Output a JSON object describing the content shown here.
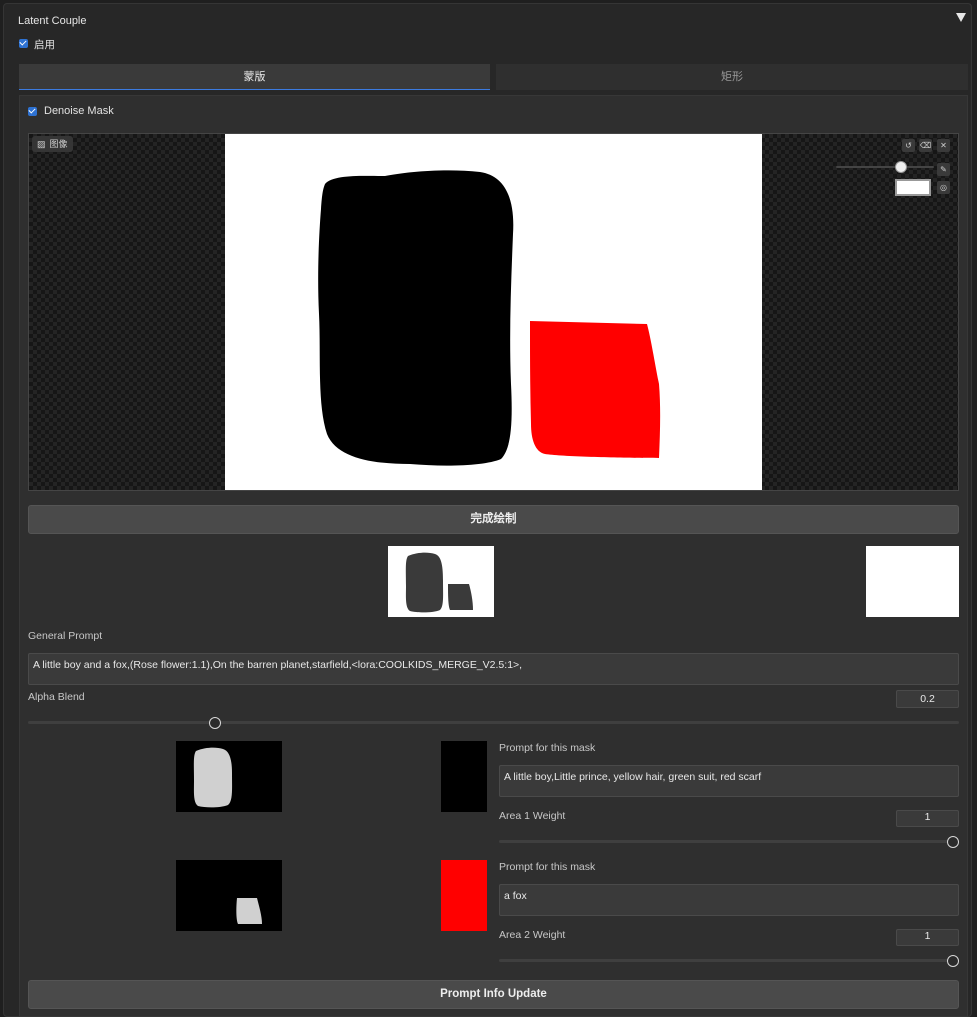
{
  "header": {
    "title": "Latent Couple",
    "enable_label": "启用"
  },
  "tabs": [
    {
      "label": "蒙版",
      "active": true
    },
    {
      "label": "矩形",
      "active": false
    }
  ],
  "denoise_label": "Denoise Mask",
  "canvas": {
    "image_label": "图像",
    "toolbar_icons": [
      "undo-icon",
      "clear-icon",
      "close-icon"
    ],
    "brush_color": "#ffffff",
    "mask_colors": [
      "#000000",
      "#ff0000"
    ]
  },
  "finish_button": "完成绘制",
  "general_prompt": {
    "label": "General Prompt",
    "value": "A little boy and a fox,(Rose flower:1.1),On the barren planet,starfield,<lora:COOLKIDS_MERGE_V2.5:1>,"
  },
  "alpha_blend": {
    "label": "Alpha Blend",
    "value": "0.2",
    "fraction": 0.2
  },
  "areas": [
    {
      "prompt_label": "Prompt for this mask",
      "prompt_value": "A little boy,Little prince, yellow hair, green suit, red scarf",
      "weight_label": "Area 1 Weight",
      "weight_value": "1",
      "color": "#000000"
    },
    {
      "prompt_label": "Prompt for this mask",
      "prompt_value": "a fox",
      "weight_label": "Area 2 Weight",
      "weight_value": "1",
      "color": "#ff0000"
    }
  ],
  "update_button": "Prompt Info Update"
}
